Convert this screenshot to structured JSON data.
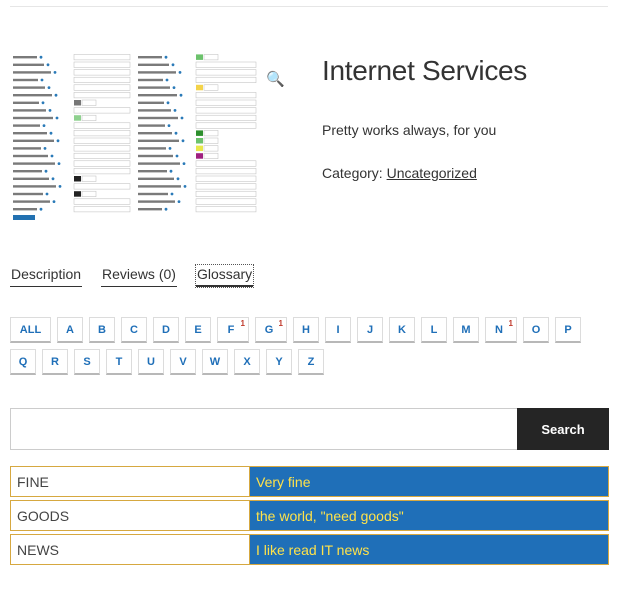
{
  "product": {
    "title": "Internet Services",
    "description": "Pretty works always, for you",
    "category_label": "Category:",
    "category_link": "Uncategorized"
  },
  "tabs": [
    {
      "label": "Description"
    },
    {
      "label": "Reviews (0)"
    },
    {
      "label": "Glossary"
    }
  ],
  "letters": {
    "row1": [
      {
        "label": "ALL",
        "sup": ""
      },
      {
        "label": "A",
        "sup": ""
      },
      {
        "label": "B",
        "sup": ""
      },
      {
        "label": "C",
        "sup": ""
      },
      {
        "label": "D",
        "sup": ""
      },
      {
        "label": "E",
        "sup": ""
      },
      {
        "label": "F",
        "sup": "1"
      },
      {
        "label": "G",
        "sup": "1"
      },
      {
        "label": "H",
        "sup": ""
      },
      {
        "label": "I",
        "sup": ""
      },
      {
        "label": "J",
        "sup": ""
      },
      {
        "label": "K",
        "sup": ""
      },
      {
        "label": "L",
        "sup": ""
      },
      {
        "label": "M",
        "sup": ""
      },
      {
        "label": "N",
        "sup": "1"
      },
      {
        "label": "O",
        "sup": ""
      },
      {
        "label": "P",
        "sup": ""
      }
    ],
    "row2": [
      {
        "label": "Q",
        "sup": ""
      },
      {
        "label": "R",
        "sup": ""
      },
      {
        "label": "S",
        "sup": ""
      },
      {
        "label": "T",
        "sup": ""
      },
      {
        "label": "U",
        "sup": ""
      },
      {
        "label": "V",
        "sup": ""
      },
      {
        "label": "W",
        "sup": ""
      },
      {
        "label": "X",
        "sup": ""
      },
      {
        "label": "Y",
        "sup": ""
      },
      {
        "label": "Z",
        "sup": ""
      }
    ]
  },
  "search": {
    "value": "",
    "placeholder": "",
    "button_label": "Search"
  },
  "glossary": [
    {
      "term": "FINE",
      "definition": "Very fine"
    },
    {
      "term": "GOODS",
      "definition": "the world, \"need goods\""
    },
    {
      "term": "NEWS",
      "definition": "I like read IT news"
    }
  ],
  "colors": {
    "accent": "#1f6fb8",
    "definition_text": "#ffe24a",
    "term_border": "#d6a840",
    "search_button": "#252525"
  },
  "icons": {
    "zoom": "magnifier-icon"
  }
}
